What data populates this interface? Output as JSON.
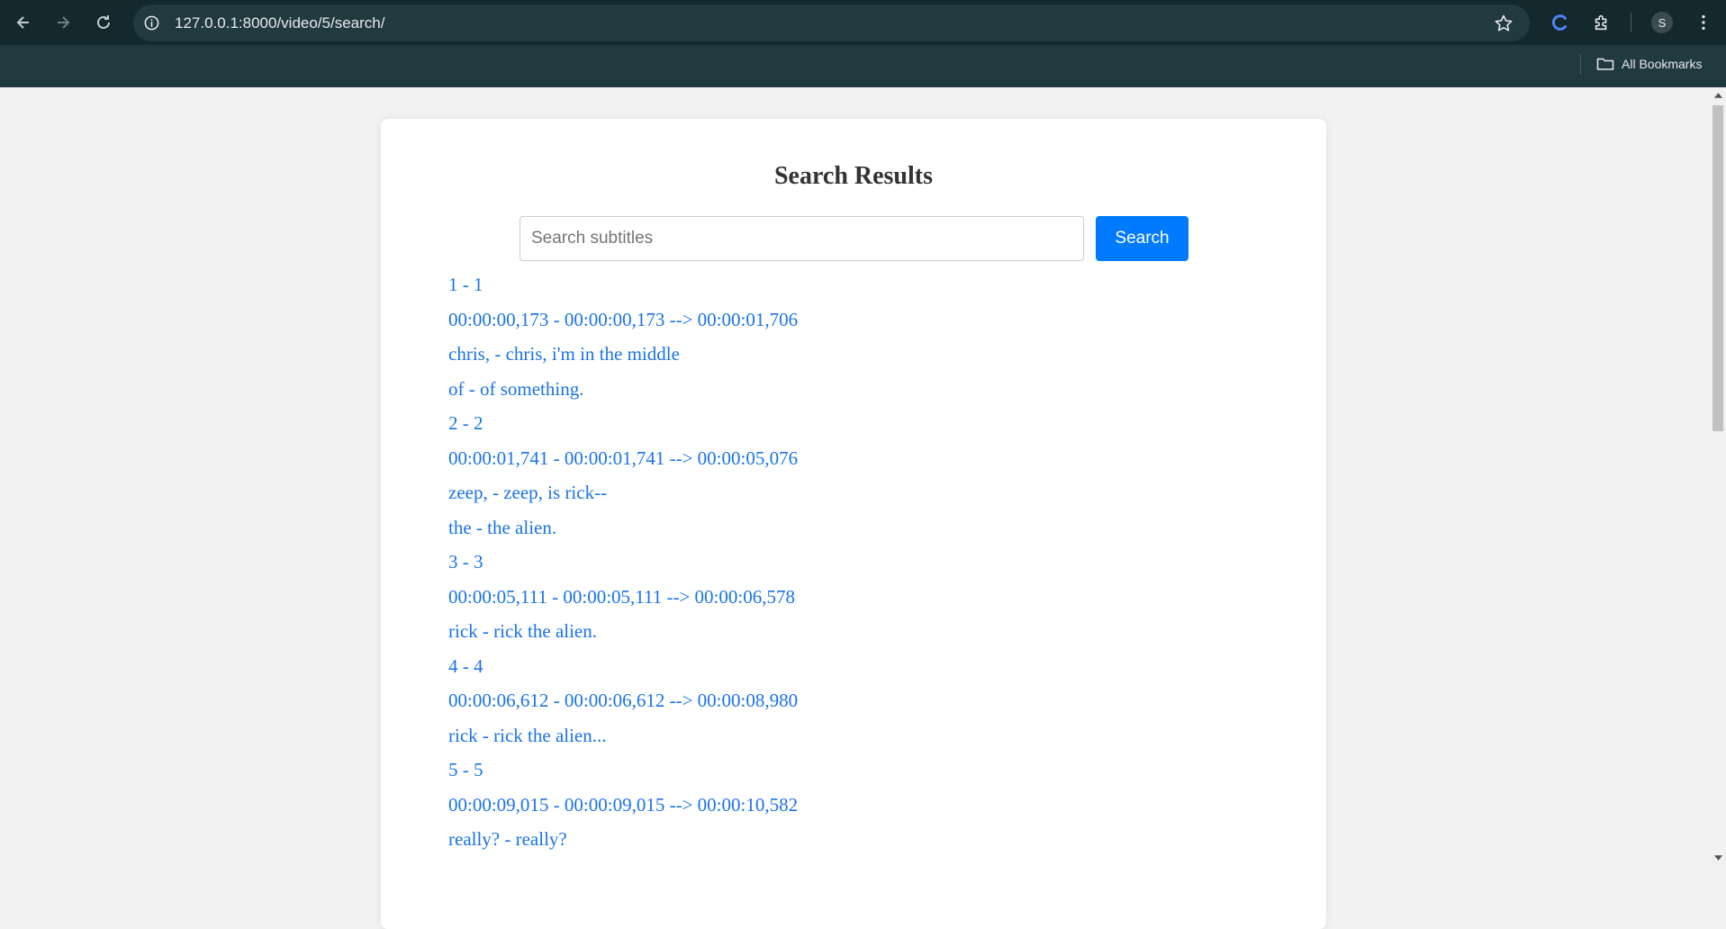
{
  "browser": {
    "url": "127.0.0.1:8000/video/5/search/",
    "profile_initial": "S",
    "bookmarks_label": "All Bookmarks"
  },
  "page": {
    "title": "Search Results",
    "search": {
      "placeholder": "Search subtitles",
      "value": "",
      "button_label": "Search"
    },
    "results": [
      "1 - 1",
      "00:00:00,173 - 00:00:00,173 --> 00:00:01,706",
      "chris, - chris, i'm in the middle",
      "of - of something.",
      "2 - 2",
      "00:00:01,741 - 00:00:01,741 --> 00:00:05,076",
      "zeep, - zeep, is rick--",
      "the - the alien.",
      "3 - 3",
      "00:00:05,111 - 00:00:05,111 --> 00:00:06,578",
      "rick - rick the alien.",
      "4 - 4",
      "00:00:06,612 - 00:00:06,612 --> 00:00:08,980",
      "rick - rick the alien...",
      "5 - 5",
      "00:00:09,015 - 00:00:09,015 --> 00:00:10,582",
      "really? - really?"
    ]
  },
  "colors": {
    "chrome_toolbar": "#14292e",
    "chrome_bookmarks_bar": "#203a40",
    "result_text": "#1a73e8",
    "search_button": "#007bff"
  }
}
